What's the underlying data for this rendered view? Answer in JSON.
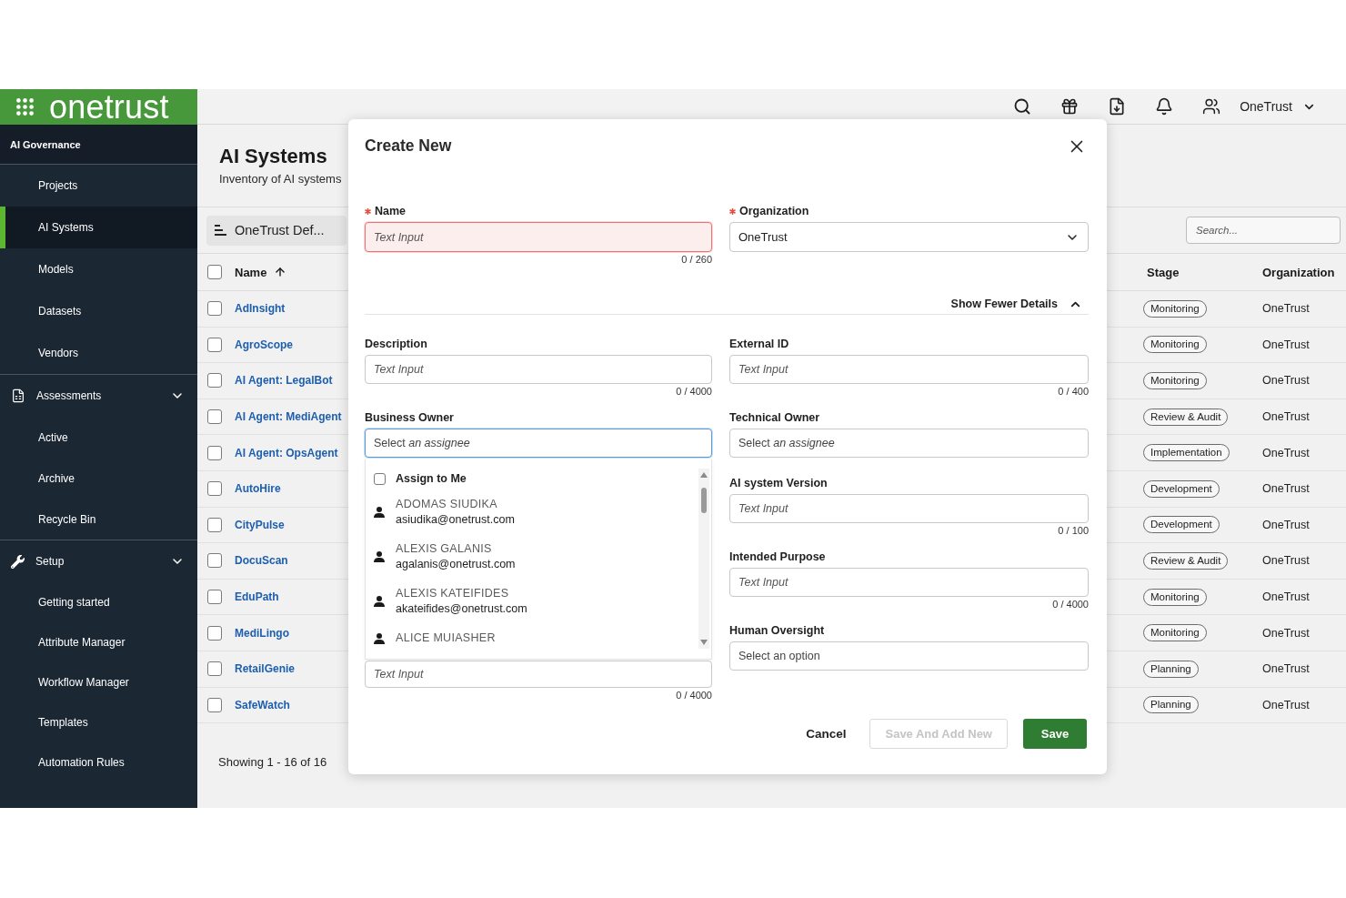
{
  "sidebar": {
    "logo": "onetrust",
    "section_title": "AI Governance",
    "groups": [
      {
        "items": [
          {
            "label": "Projects",
            "selected": false
          },
          {
            "label": "AI Systems",
            "selected": true
          },
          {
            "label": "Models",
            "selected": false
          },
          {
            "label": "Datasets",
            "selected": false
          },
          {
            "label": "Vendors",
            "selected": false
          }
        ]
      },
      {
        "title": "Assessments",
        "expanded": true,
        "items": [
          {
            "label": "Active",
            "selected": false
          },
          {
            "label": "Archive",
            "selected": false
          },
          {
            "label": "Recycle Bin",
            "selected": false
          }
        ]
      },
      {
        "title": "Setup",
        "expanded": true,
        "items": [
          {
            "label": "Getting started",
            "selected": false
          },
          {
            "label": "Attribute Manager",
            "selected": false
          },
          {
            "label": "Workflow Manager",
            "selected": false
          },
          {
            "label": "Templates",
            "selected": false
          },
          {
            "label": "Automation Rules",
            "selected": false
          }
        ]
      }
    ]
  },
  "top_bar": {
    "account": "OneTrust"
  },
  "page": {
    "title": "AI Systems",
    "subtitle": "Inventory of AI systems"
  },
  "toolbar": {
    "view": "OneTrust Def...",
    "search": {
      "placeholder": "Search..."
    }
  },
  "table": {
    "header_checkbox": {
      "checked": false
    },
    "columns": [
      {
        "label": "Name",
        "sorted": true
      },
      {
        "label": "Stage",
        "sorted": false
      },
      {
        "label": "Organization",
        "sorted": false
      }
    ],
    "rows": [
      {
        "checked": false,
        "name": "AdInsight",
        "stage": "Monitoring",
        "organization": "OneTrust"
      },
      {
        "checked": false,
        "name": "AgroScope",
        "stage": "Monitoring",
        "organization": "OneTrust"
      },
      {
        "checked": false,
        "name": "AI Agent: LegalBot",
        "stage": "Monitoring",
        "organization": "OneTrust"
      },
      {
        "checked": false,
        "name": "AI Agent: MediAgent",
        "stage": "Review & Audit",
        "organization": "OneTrust"
      },
      {
        "checked": false,
        "name": "AI Agent: OpsAgent",
        "stage": "Implementation",
        "organization": "OneTrust"
      },
      {
        "checked": false,
        "name": "AutoHire",
        "stage": "Development",
        "organization": "OneTrust"
      },
      {
        "checked": false,
        "name": "CityPulse",
        "stage": "Development",
        "organization": "OneTrust"
      },
      {
        "checked": false,
        "name": "DocuScan",
        "stage": "Review & Audit",
        "organization": "OneTrust"
      },
      {
        "checked": false,
        "name": "EduPath",
        "stage": "Monitoring",
        "organization": "OneTrust"
      },
      {
        "checked": false,
        "name": "MediLingo",
        "stage": "Monitoring",
        "organization": "OneTrust"
      },
      {
        "checked": false,
        "name": "RetailGenie",
        "stage": "Planning",
        "organization": "OneTrust"
      },
      {
        "checked": false,
        "name": "SafeWatch",
        "stage": "Planning",
        "organization": "OneTrust"
      }
    ],
    "summary": "Showing 1 - 16 of 16"
  },
  "modal": {
    "title": "Create New",
    "top_fields": [
      {
        "label": "Name",
        "required": true,
        "kind": "text",
        "placeholder": "Text Input",
        "counter": "0 / 260",
        "error": true,
        "focused": false
      },
      {
        "label": "Organization",
        "required": true,
        "kind": "select",
        "value": "OneTrust",
        "error": false,
        "focused": false
      }
    ],
    "details_toggle": {
      "label": "Show Fewer Details",
      "expanded": true
    },
    "left_fields": [
      {
        "label": "Description",
        "required": false,
        "kind": "text",
        "placeholder": "Text Input",
        "counter": "0 / 4000",
        "error": false,
        "focused": false
      },
      {
        "label": "Business Owner",
        "required": false,
        "kind": "lookup",
        "placeholder": "Select *an assignee*",
        "error": false,
        "focused": true,
        "dropdown": {
          "assign_to_me": {
            "label": "Assign to Me",
            "checked": false
          },
          "people": [
            {
              "name": "ADOMAS SIUDIKA",
              "email": "asiudika@onetrust.com"
            },
            {
              "name": "ALEXIS GALANIS",
              "email": "agalanis@onetrust.com"
            },
            {
              "name": "ALEXIS KATEIFIDES",
              "email": "akateifides@onetrust.com"
            },
            {
              "name": "ALICE MUIASHER"
            }
          ]
        }
      },
      {
        "kind": "text",
        "placeholder": "Text Input",
        "counter": "0 / 4000",
        "error": false,
        "focused": false
      }
    ],
    "right_fields": [
      {
        "label": "External ID",
        "required": false,
        "kind": "text",
        "placeholder": "Text Input",
        "counter": "0 / 400",
        "error": false,
        "focused": false
      },
      {
        "label": "Technical Owner",
        "required": false,
        "kind": "lookup",
        "placeholder": "Select *an assignee*",
        "error": false,
        "focused": false
      },
      {
        "label": "AI system Version",
        "required": false,
        "kind": "text",
        "placeholder": "Text Input",
        "counter": "0 / 100",
        "error": false,
        "focused": false
      },
      {
        "label": "Intended Purpose",
        "required": false,
        "kind": "text",
        "placeholder": "Text Input",
        "counter": "0 / 4000",
        "error": false,
        "focused": false
      },
      {
        "label": "Human Oversight",
        "required": false,
        "kind": "lookup",
        "placeholder": "Select an option",
        "error": false,
        "focused": false
      }
    ],
    "buttons": [
      {
        "label": "Cancel",
        "kind": "text",
        "disabled": false
      },
      {
        "label": "Save And Add New",
        "kind": "outline",
        "disabled": true
      },
      {
        "label": "Save",
        "kind": "primary",
        "disabled": false
      }
    ]
  }
}
